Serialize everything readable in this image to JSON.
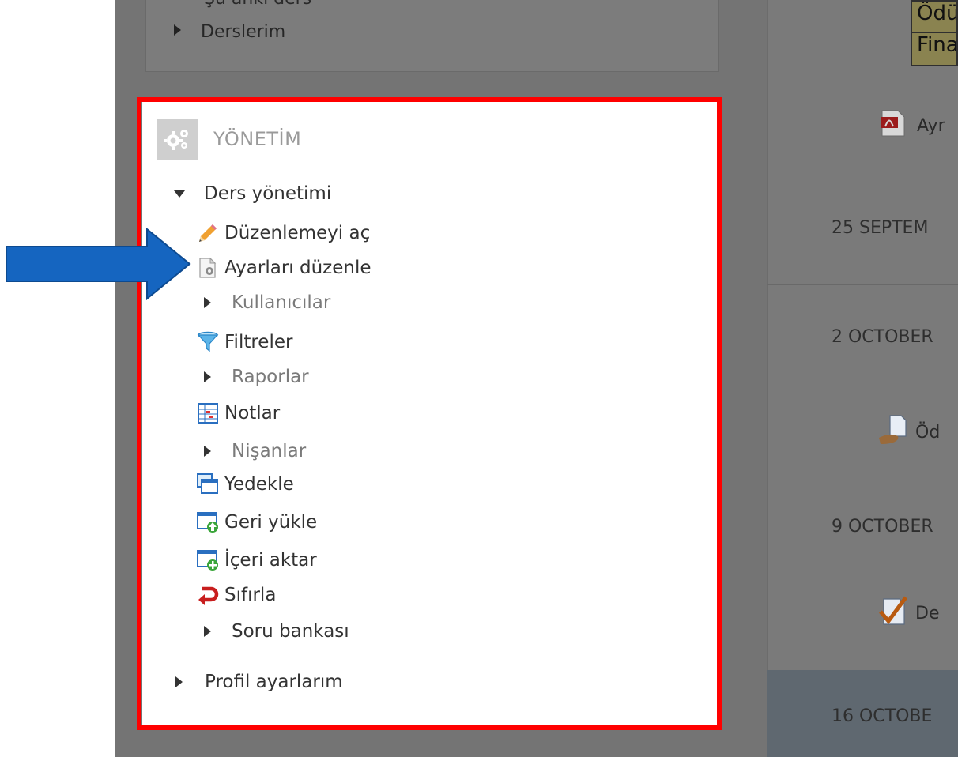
{
  "sidebar": {
    "prev_cut_text": "Şu anki ders",
    "prev_item": "Derslerim",
    "admin": {
      "title": "YÖNETİM",
      "course_admin": "Ders yönetimi",
      "items": [
        {
          "label": "Düzenlemeyi aç",
          "icon": "pencil-icon"
        },
        {
          "label": "Ayarları düzenle",
          "icon": "settings-page-icon"
        },
        {
          "label": "Kullanıcılar",
          "icon": "caret-right-icon"
        },
        {
          "label": "Filtreler",
          "icon": "filter-icon"
        },
        {
          "label": "Raporlar",
          "icon": "caret-right-icon"
        },
        {
          "label": "Notlar",
          "icon": "grades-icon"
        },
        {
          "label": "Nişanlar",
          "icon": "caret-right-icon"
        },
        {
          "label": "Yedekle",
          "icon": "backup-icon"
        },
        {
          "label": "Geri yükle",
          "icon": "restore-icon"
        },
        {
          "label": "İçeri aktar",
          "icon": "import-icon"
        },
        {
          "label": "Sıfırla",
          "icon": "reset-icon"
        },
        {
          "label": "Soru bankası",
          "icon": "caret-right-icon"
        }
      ],
      "profile": "Profil ayarlarım"
    }
  },
  "main": {
    "top_cells": [
      "Ödü",
      "Fina"
    ],
    "pdf_link": "Ayr",
    "dates": [
      "25 SEPTEM",
      "2 OCTOBER",
      "9 OCTOBER",
      "16 OCTOBE"
    ],
    "assignment_link": "Öd",
    "quiz_link": "De"
  },
  "colors": {
    "highlight": "#ff0000",
    "arrow": "#1565c0"
  }
}
